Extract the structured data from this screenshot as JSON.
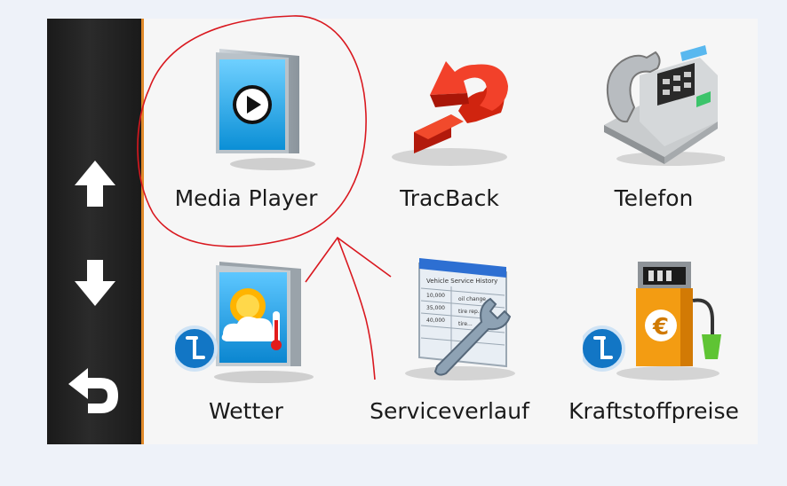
{
  "sidebar": {
    "up_icon": "arrow-up-icon",
    "down_icon": "arrow-down-icon",
    "back_icon": "back-arrow-icon"
  },
  "apps": [
    {
      "label": "Media Player",
      "icon": "media-player-icon"
    },
    {
      "label": "TracBack",
      "icon": "tracback-icon"
    },
    {
      "label": "Telefon",
      "icon": "telephone-icon"
    },
    {
      "label": "Wetter",
      "icon": "weather-icon"
    },
    {
      "label": "Serviceverlauf",
      "icon": "service-history-icon"
    },
    {
      "label": "Kraftstoffpreise",
      "icon": "fuel-prices-icon"
    }
  ],
  "service_card": {
    "title": "Vehicle Service History",
    "rows": [
      [
        "10,000",
        "oil change"
      ],
      [
        "35,000",
        "tire rep..."
      ],
      [
        "40,000",
        "tire..."
      ]
    ]
  },
  "colors": {
    "sidebar_edge": "#e08a2a",
    "annotation_ink": "#d9181f"
  }
}
